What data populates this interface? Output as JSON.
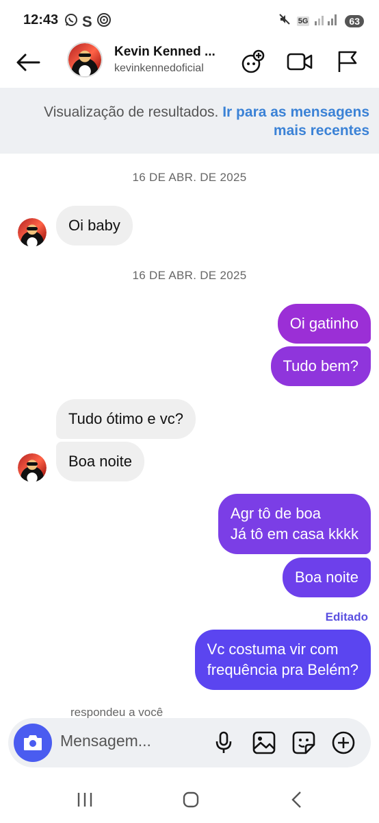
{
  "status_bar": {
    "time": "12:43",
    "battery": "63",
    "network": "5G",
    "icons": [
      "whatsapp-icon",
      "s-icon",
      "hotspot-icon",
      "mute-icon",
      "signal-icon",
      "battery-icon"
    ]
  },
  "header": {
    "contact_name": "Kevin Kenned ...",
    "contact_username": "kevinkennedoficial",
    "icons": [
      "back-arrow-icon",
      "add-effect-icon",
      "video-call-icon",
      "flag-icon"
    ]
  },
  "banner": {
    "text": "Visualização de resultados.",
    "link_line1": "Ir para as mensagens",
    "link_line2": "mais recentes"
  },
  "messages": {
    "date1": "16 DE ABR. DE 2025",
    "date2": "16 DE ABR. DE 2025",
    "m1": "Oi baby",
    "m2": "Oi gatinho",
    "m3": "Tudo bem?",
    "m4": "Tudo ótimo e vc?",
    "m5": "Boa noite",
    "m6_line1": "Agr tô de boa",
    "m6_line2": "Já tô em casa kkkk",
    "m7": "Boa noite",
    "edited_label": "Editado",
    "m8_line1": "Vc costuma vir com",
    "m8_line2": "frequência pra Belém?",
    "replied_label": "respondeu a você"
  },
  "composer": {
    "placeholder": "Mensagem...",
    "icons": [
      "camera-icon",
      "microphone-icon",
      "image-icon",
      "sticker-icon",
      "plus-circle-icon"
    ]
  },
  "colors": {
    "outgoing_top": "#9b2fd6",
    "outgoing_mid": "#7b3ee6",
    "outgoing_bottom": "#5b45f0",
    "incoming": "#efefef",
    "link": "#3b82d6",
    "camera_button": "#4a5cf0"
  }
}
